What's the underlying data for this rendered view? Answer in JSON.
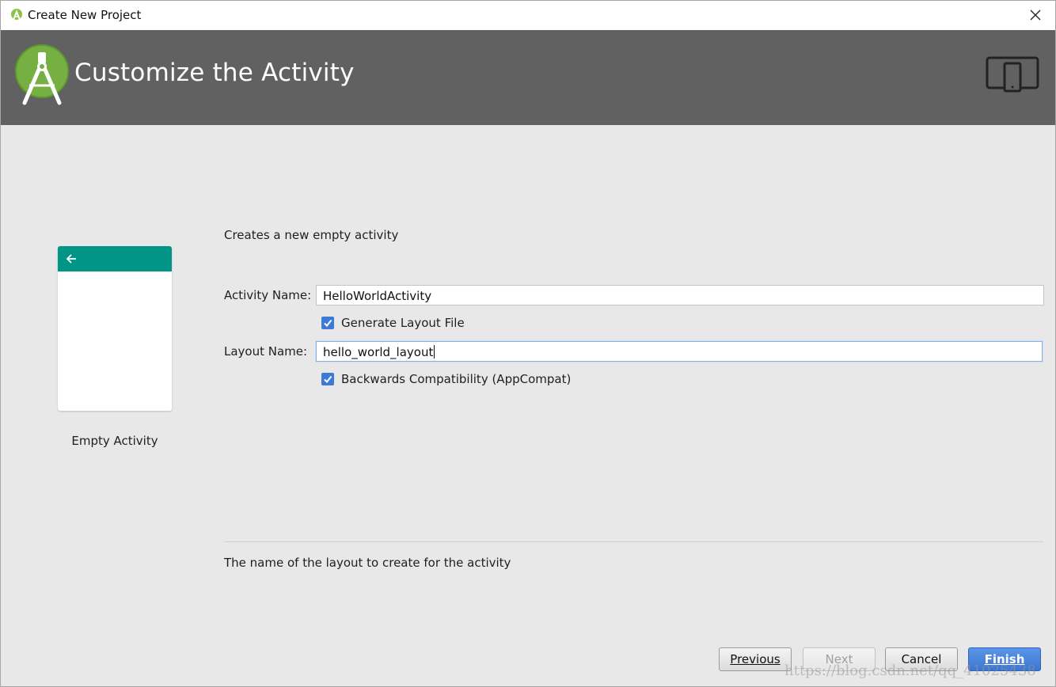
{
  "window": {
    "title": "Create New Project"
  },
  "header": {
    "heading": "Customize the Activity"
  },
  "preview": {
    "caption": "Empty Activity",
    "appbar_color": "#009587"
  },
  "form": {
    "description": "Creates a new empty activity",
    "activity_name_label": "Activity Name:",
    "activity_name_value": "HelloWorldActivity",
    "generate_layout_label": "Generate Layout File",
    "generate_layout_checked": true,
    "layout_name_label": "Layout Name:",
    "layout_name_value": "hello_world_layout",
    "backwards_compat_label": "Backwards Compatibility (AppCompat)",
    "backwards_compat_checked": true,
    "hint": "The name of the layout to create for the activity"
  },
  "buttons": {
    "previous": "Previous",
    "next": "Next",
    "cancel": "Cancel",
    "finish": "Finish"
  },
  "watermark": "https://blog.csdn.net/qq_41025438",
  "colors": {
    "header_bg": "#616161",
    "accent": "#3d7ad6",
    "android_green": "#a4c639"
  },
  "icons": {
    "app": "android-studio-icon",
    "close": "close-icon",
    "logo": "android-studio-logo",
    "device": "tablet-phone-icon",
    "back": "back-arrow-icon",
    "check": "checkmark-icon"
  }
}
